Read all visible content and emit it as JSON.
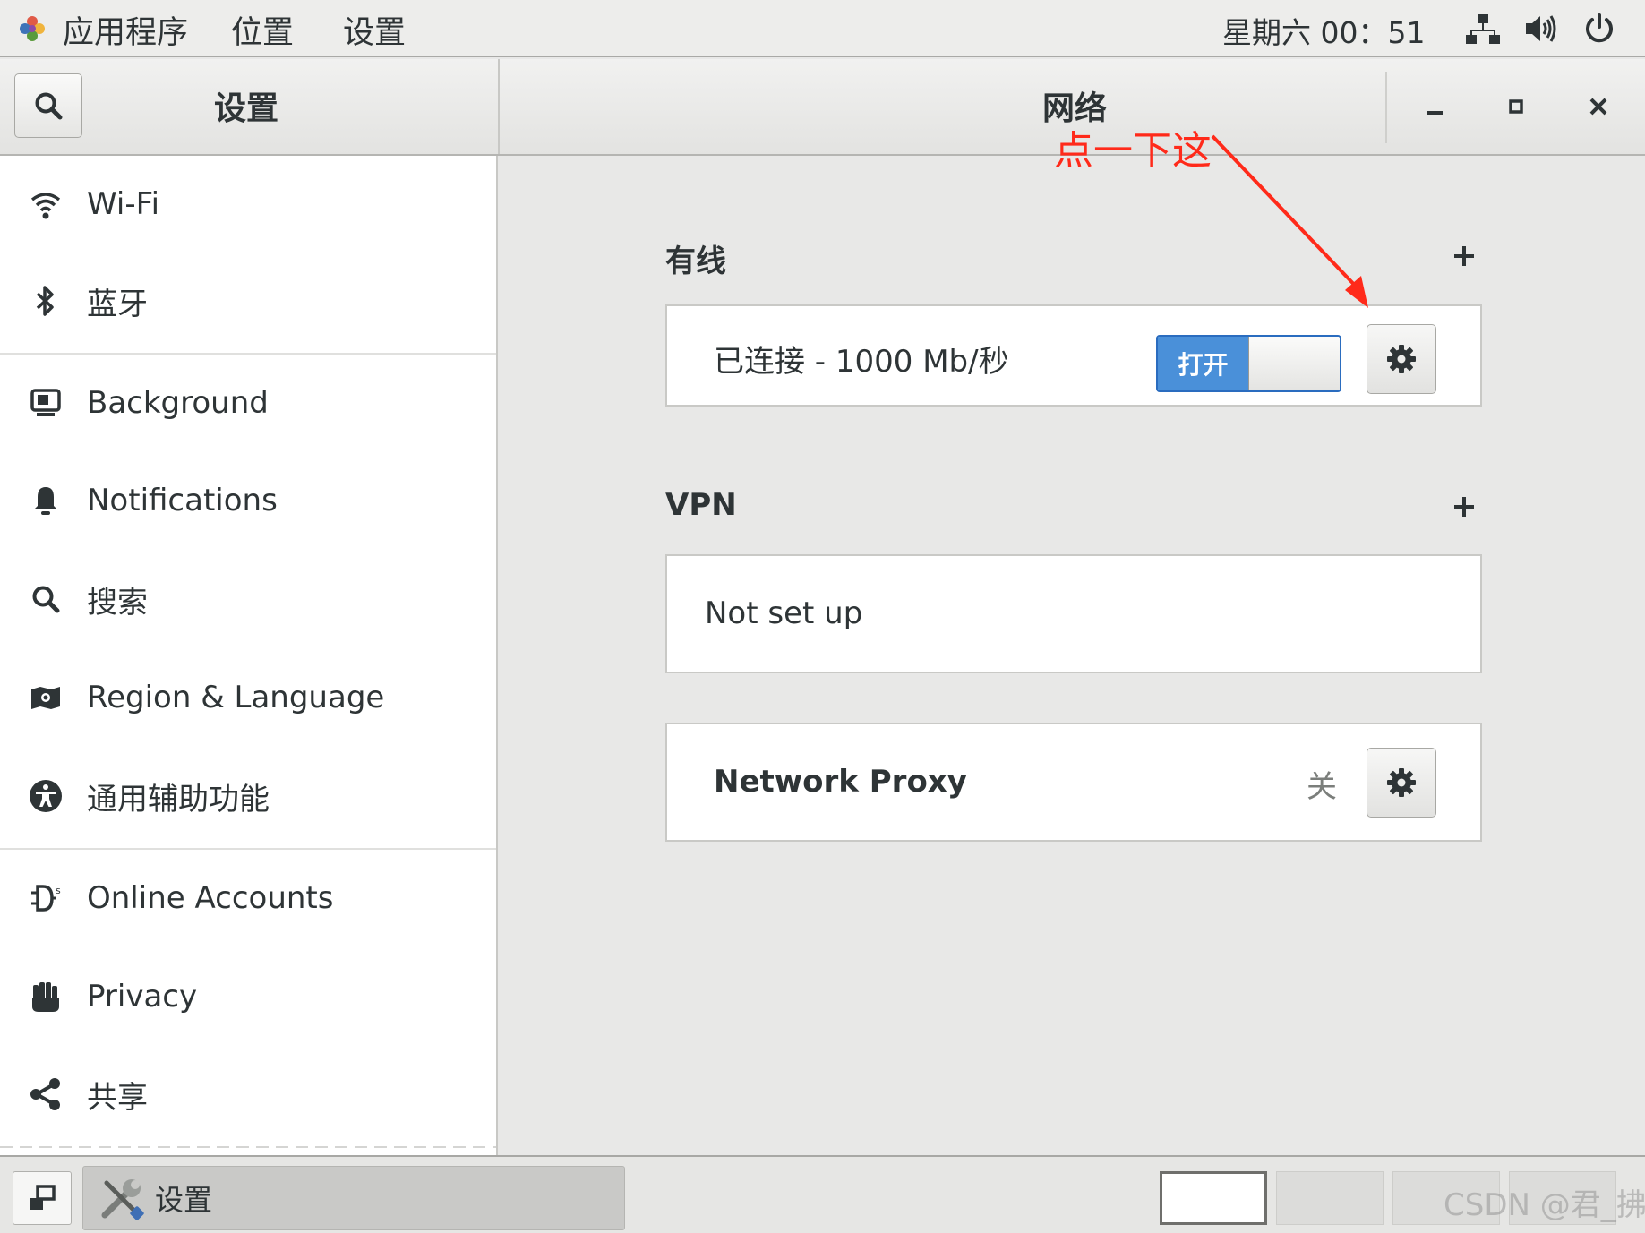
{
  "topbar": {
    "apps_menu": "应用程序",
    "places_menu": "位置",
    "settings_menu": "设置",
    "clock": "星期六 00：51",
    "icons": [
      "network-wired-icon",
      "volume-icon",
      "power-icon"
    ]
  },
  "header": {
    "sidebar_title": "设置",
    "panel_title": "网络",
    "search_icon": "search-icon",
    "window_controls": [
      "minimize-icon",
      "maximize-icon",
      "close-icon"
    ]
  },
  "sidebar": {
    "items": [
      {
        "label": "Wi-Fi",
        "icon": "wifi-icon"
      },
      {
        "label": "蓝牙",
        "icon": "bluetooth-icon"
      },
      {
        "label": "Background",
        "icon": "background-icon"
      },
      {
        "label": "Notifications",
        "icon": "bell-icon"
      },
      {
        "label": "搜索",
        "icon": "search-icon"
      },
      {
        "label": "Region & Language",
        "icon": "region-icon"
      },
      {
        "label": "通用辅助功能",
        "icon": "accessibility-icon"
      },
      {
        "label": "Online Accounts",
        "icon": "online-accounts-icon"
      },
      {
        "label": "Privacy",
        "icon": "hand-icon"
      },
      {
        "label": "共享",
        "icon": "share-icon"
      }
    ]
  },
  "network": {
    "wired": {
      "title": "有线",
      "status": "已连接 - 1000 Mb/秒",
      "switch_label": "打开",
      "switch_on": true
    },
    "vpn": {
      "title": "VPN",
      "empty_text": "Not set up"
    },
    "proxy": {
      "label": "Network Proxy",
      "state": "关"
    }
  },
  "annotation": {
    "text": "点一下这",
    "color": "#ff2a1a"
  },
  "taskbar": {
    "task_label": "设置",
    "watermark": "CSDN @君_拂"
  },
  "colors": {
    "accent": "#4a90d9",
    "sidebar_bg": "#ffffff",
    "panel_bg": "#e8e8e7"
  }
}
